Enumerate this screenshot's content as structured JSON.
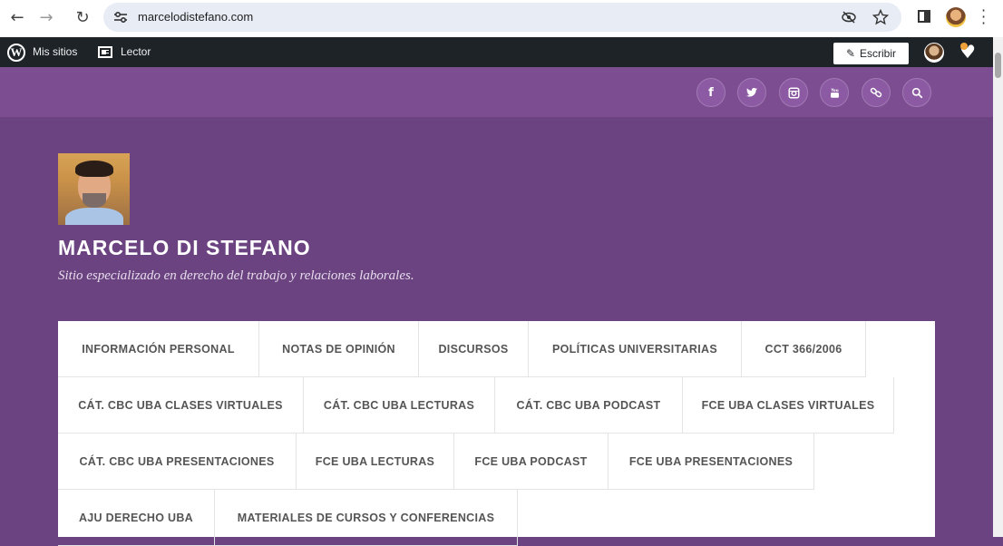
{
  "browser": {
    "url": "marcelodistefano.com",
    "back_icon": "←",
    "forward_icon": "→",
    "reload_icon": "↻"
  },
  "wpbar": {
    "my_sites": "Mis sitios",
    "reader": "Lector",
    "write": "Escribir"
  },
  "site": {
    "title": "MARCELO DI STEFANO",
    "tagline": "Sitio especializado en derecho del trabajo y relaciones laborales.",
    "social": [
      {
        "name": "facebook-icon",
        "glyph": "f"
      },
      {
        "name": "twitter-icon",
        "glyph": "🐦"
      },
      {
        "name": "instagram-icon",
        "glyph": "◙"
      },
      {
        "name": "youtube-icon",
        "glyph": "▶"
      },
      {
        "name": "link-icon",
        "glyph": "🔗"
      },
      {
        "name": "search-icon",
        "glyph": "⌕"
      }
    ]
  },
  "menu": {
    "items": [
      "INFORMACIÓN PERSONAL",
      "NOTAS DE OPINIÓN",
      "DISCURSOS",
      "POLÍTICAS UNIVERSITARIAS",
      "CCT 366/2006",
      "CÁT. CBC UBA CLASES VIRTUALES",
      "CÁT. CBC UBA LECTURAS",
      "CÁT. CBC UBA PODCAST",
      "FCE UBA CLASES VIRTUALES",
      "CÁT. CBC UBA PRESENTACIONES",
      "FCE UBA LECTURAS",
      "FCE UBA PODCAST",
      "FCE UBA PRESENTACIONES",
      "AJU DERECHO UBA",
      "MATERIALES DE CURSOS Y CONFERENCIAS"
    ]
  }
}
